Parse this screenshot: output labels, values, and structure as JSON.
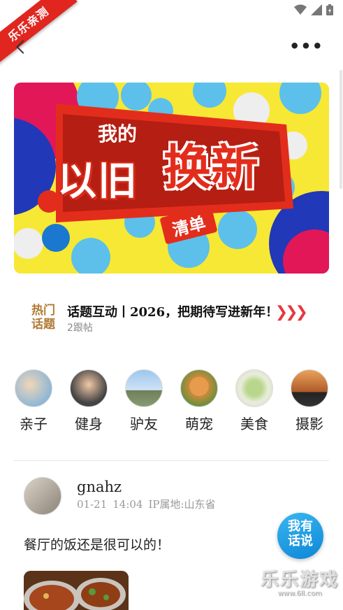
{
  "ribbon": {
    "text": "乐乐亲测"
  },
  "banner": {
    "line1": "我的",
    "line2": "以旧",
    "highlight": "换新",
    "tag": "清单"
  },
  "hot_topic": {
    "logo_line1": "热门",
    "logo_line2": "话题",
    "title": "话题互动丨2026，把期待写进新年！",
    "followers": "2跟帖",
    "arrow": "❯❯❯"
  },
  "categories": [
    {
      "label": "亲子",
      "icon": "family-photo"
    },
    {
      "label": "健身",
      "icon": "fitness-photo"
    },
    {
      "label": "驴友",
      "icon": "hiker-photo"
    },
    {
      "label": "萌宠",
      "icon": "corgi-photo"
    },
    {
      "label": "美食",
      "icon": "food-photo"
    },
    {
      "label": "摄影",
      "icon": "photographer-photo"
    }
  ],
  "post": {
    "username": "gnahz",
    "date": "01-21",
    "time": "14:04",
    "location": "IP属地:山东省",
    "text": "餐厅的饭还是很可以的！"
  },
  "fab": {
    "line1": "我有",
    "line2": "话说"
  },
  "watermark": {
    "name": "乐乐游戏",
    "url": "www.6ll.com"
  },
  "colors": {
    "accent_red": "#e32d1c",
    "banner_yellow": "#f7e835",
    "fab_blue": "#1a95e0",
    "hot_brown": "#b07a35"
  }
}
